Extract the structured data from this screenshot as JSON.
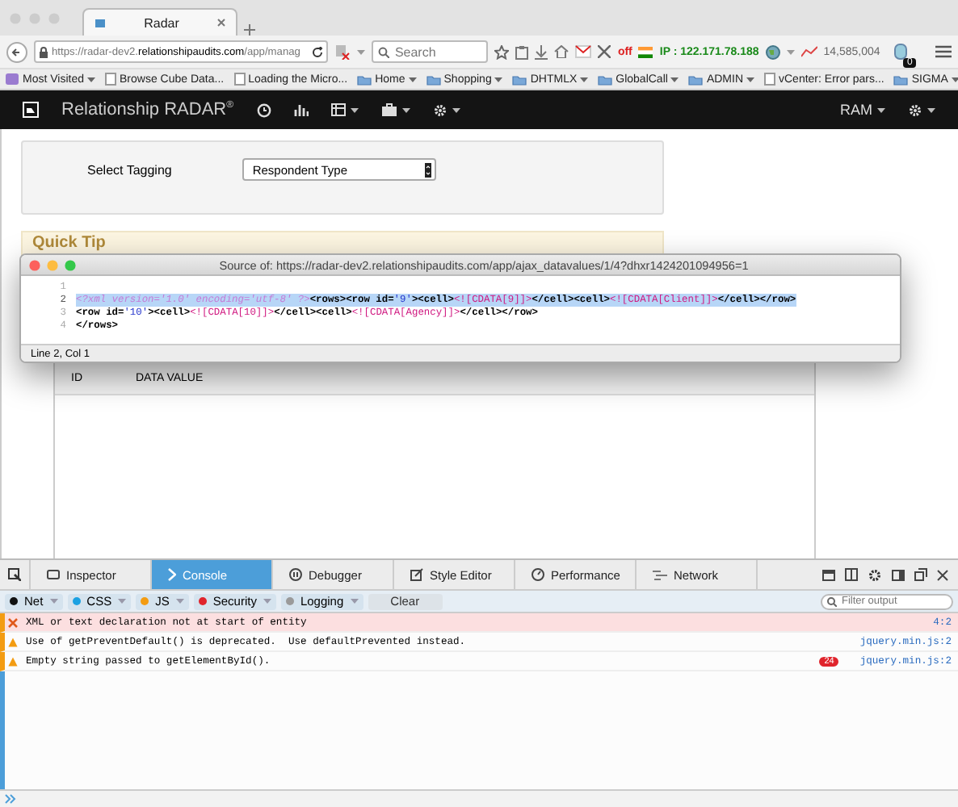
{
  "browser": {
    "tabs": [
      {
        "title": "Radar",
        "selected": true
      }
    ],
    "url": "https://radar-dev2.**relationshipaudits.com**/app/manag",
    "search": {
      "placeholder": "Search"
    },
    "addons": {
      "status": "off",
      "ip": "IP : 122.171.78.188",
      "counter": "14,585,004",
      "badge": "0"
    },
    "bookmarks": [
      {
        "label": "Most Visited",
        "kind": "special",
        "dropdown": true
      },
      {
        "label": "Browse Cube Data...",
        "kind": "page",
        "dropdown": false
      },
      {
        "label": "Loading the Micro...",
        "kind": "page",
        "dropdown": false
      },
      {
        "label": "Home",
        "kind": "folder",
        "dropdown": true
      },
      {
        "label": "Shopping",
        "kind": "folder",
        "dropdown": true
      },
      {
        "label": "DHTMLX",
        "kind": "folder",
        "dropdown": true
      },
      {
        "label": "GlobalCall",
        "kind": "folder",
        "dropdown": true
      },
      {
        "label": "ADMIN",
        "kind": "folder",
        "dropdown": true
      },
      {
        "label": "vCenter: Error pars...",
        "kind": "page",
        "dropdown": false
      },
      {
        "label": "SIGMA",
        "kind": "folder",
        "dropdown": true
      }
    ]
  },
  "app": {
    "brand": "Relationship RADAR$^{®}$",
    "user": "RAM",
    "tagging": {
      "label": "Select Tagging",
      "value": "Respondent Type"
    },
    "quick_tip": {
      "title": "Quick Tip"
    },
    "table": {
      "columns": [
        "ID",
        "DATA VALUE"
      ]
    }
  },
  "source_window": {
    "title": "Source of: https://radar-dev2.relationshipaudits.com/app/ajax_datavalues/1/4?dhxr1424201094956=1",
    "lines": [
      {
        "number": "1",
        "selected": false
      },
      {
        "number": "2",
        "selected": true,
        "tokens": [
          {
            "text": "<?xml version='1.0' encoding='utf-8' ?>",
            "kind": "pi"
          },
          {
            "text": "<rows><row id=",
            "kind": "tag"
          },
          {
            "text": "'9'",
            "kind": "value"
          },
          {
            "text": "><cell>",
            "kind": "tag"
          },
          {
            "text": "<![CDATA[9]]>",
            "kind": "cdata"
          },
          {
            "text": "</cell><cell>",
            "kind": "tag"
          },
          {
            "text": "<![CDATA[Client]]>",
            "kind": "cdata"
          },
          {
            "text": "</cell></row>",
            "kind": "tag"
          }
        ]
      },
      {
        "number": "3",
        "selected": false,
        "tokens": [
          {
            "text": "<row id=",
            "kind": "tag"
          },
          {
            "text": "'10'",
            "kind": "value"
          },
          {
            "text": "><cell>",
            "kind": "tag"
          },
          {
            "text": "<![CDATA[10]]>",
            "kind": "cdata"
          },
          {
            "text": "</cell><cell>",
            "kind": "tag"
          },
          {
            "text": "<![CDATA[Agency]]>",
            "kind": "cdata"
          },
          {
            "text": "</cell></row>",
            "kind": "tag"
          }
        ]
      },
      {
        "number": "4",
        "selected": false,
        "tokens": [
          {
            "text": "</rows>",
            "kind": "tag"
          }
        ]
      }
    ],
    "status": "Line 2, Col 1"
  },
  "devtools": {
    "tabs": [
      {
        "label": "Inspector",
        "selected": false
      },
      {
        "label": "Console",
        "selected": true
      },
      {
        "label": "Debugger",
        "selected": false
      },
      {
        "label": "Style Editor",
        "selected": false
      },
      {
        "label": "Performance",
        "selected": false
      },
      {
        "label": "Network",
        "selected": false
      }
    ],
    "filters": [
      {
        "label": "Net",
        "kind": "filter",
        "color": "#111111"
      },
      {
        "label": "CSS",
        "kind": "filter",
        "color": "#1ba1e2"
      },
      {
        "label": "JS",
        "kind": "filter",
        "color": "#f39c12"
      },
      {
        "label": "Security",
        "kind": "filter",
        "color": "#e0242c"
      },
      {
        "label": "Logging",
        "kind": "filter",
        "color": "#9a9a9a"
      },
      {
        "label": "Clear",
        "kind": "button"
      }
    ],
    "filter_field": {
      "placeholder": "Filter output"
    },
    "messages": [
      {
        "kind": "error",
        "text": "XML or text declaration not at start of entity",
        "source": "4:2"
      },
      {
        "kind": "warning",
        "text": "Use of getPreventDefault() is deprecated.  Use defaultPrevented instead.",
        "source": "jquery.min.js:2"
      },
      {
        "kind": "warning",
        "text": "Empty string passed to getElementById().",
        "source": "jquery.min.js:2",
        "count": "24"
      }
    ]
  }
}
